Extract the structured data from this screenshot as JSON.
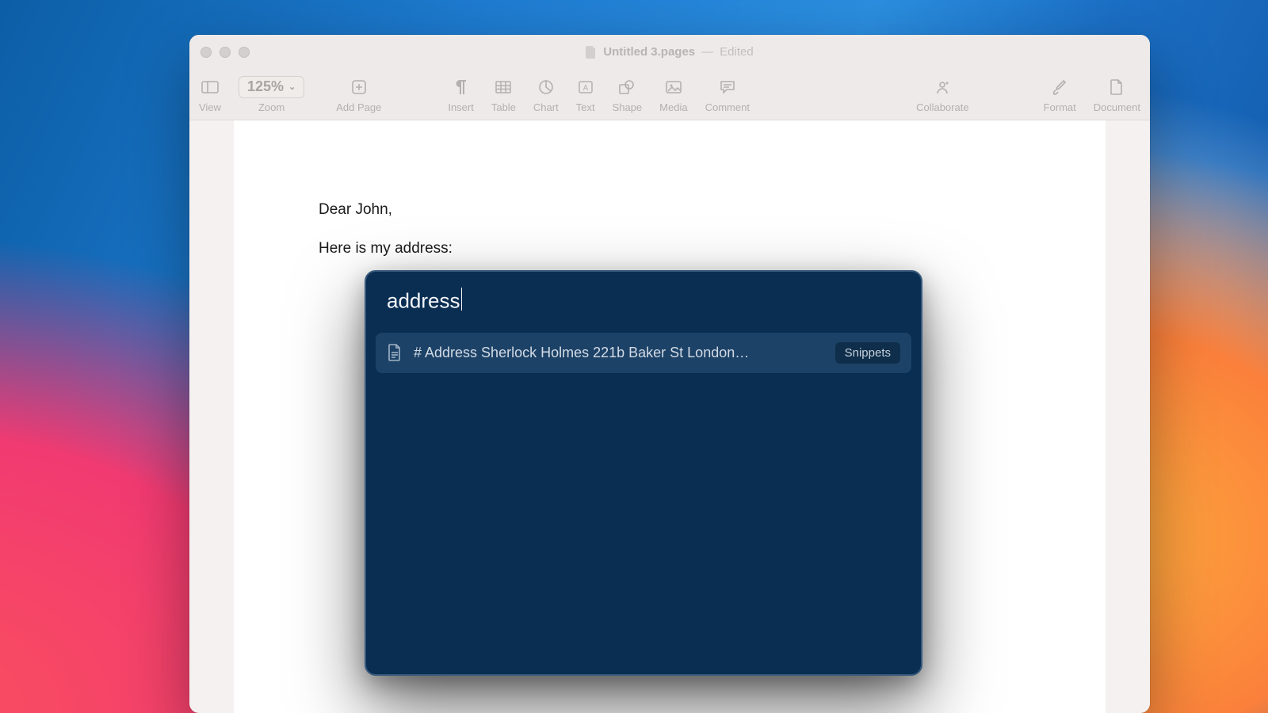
{
  "window": {
    "title": "Untitled 3.pages",
    "status": "Edited",
    "separator": "—"
  },
  "toolbar": {
    "view": "View",
    "zoom_label": "Zoom",
    "zoom_value": "125%",
    "add_page": "Add Page",
    "insert": "Insert",
    "table": "Table",
    "chart": "Chart",
    "text": "Text",
    "shape": "Shape",
    "media": "Media",
    "comment": "Comment",
    "collaborate": "Collaborate",
    "format": "Format",
    "document": "Document"
  },
  "document": {
    "line1": "Dear John,",
    "line2": "Here is my address:"
  },
  "launcher": {
    "query": "address",
    "results": [
      {
        "text": "# Address Sherlock Holmes 221b Baker St London…",
        "tag": "Snippets"
      }
    ]
  }
}
